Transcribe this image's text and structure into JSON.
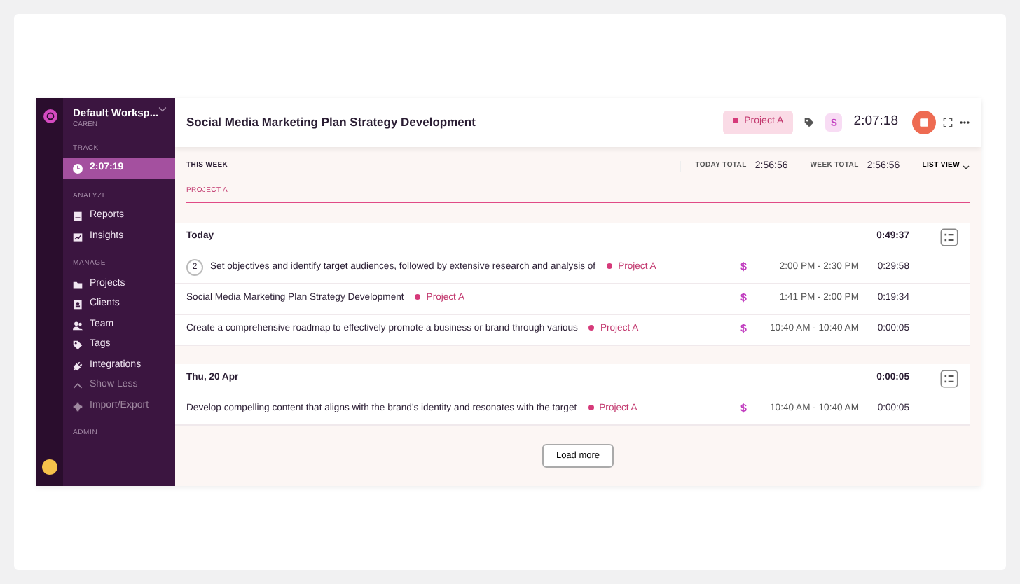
{
  "workspace": {
    "title": "Default Worksp...",
    "subtitle": "CAREN"
  },
  "sidebar": [
    {
      "heading": "TRACK",
      "items": [
        {
          "label": "2:07:19",
          "selected": true,
          "dimmed": false
        }
      ]
    },
    {
      "heading": "ANALYZE",
      "items": [
        {
          "label": "Reports",
          "selected": false,
          "dimmed": false
        },
        {
          "label": "Insights",
          "selected": false,
          "dimmed": false
        }
      ]
    },
    {
      "heading": "MANAGE",
      "items": [
        {
          "label": "Projects",
          "selected": false,
          "dimmed": false
        },
        {
          "label": "Clients",
          "selected": false,
          "dimmed": false
        },
        {
          "label": "Team",
          "selected": false,
          "dimmed": false
        },
        {
          "label": "Tags",
          "selected": false,
          "dimmed": false
        },
        {
          "label": "Integrations",
          "selected": false,
          "dimmed": false
        },
        {
          "label": "Show Less",
          "selected": false,
          "dimmed": true
        },
        {
          "label": "Import/Export",
          "selected": false,
          "dimmed": true
        }
      ]
    },
    {
      "heading": "ADMIN"
    }
  ],
  "timer": {
    "description": "Social Media Marketing Plan Strategy Development",
    "project": "Project A",
    "billable_symbol": "$",
    "elapsed": "2:07:18"
  },
  "summary": {
    "period": "THIS WEEK",
    "today_label": "TODAY TOTAL",
    "today_total": "2:56:56",
    "week_label": "WEEK TOTAL",
    "week_total": "2:56:56",
    "view": "LIST VIEW"
  },
  "filter": {
    "project": "PROJECT A"
  },
  "groups": [
    {
      "date": "Today",
      "total": "0:49:37",
      "entries": [
        {
          "count": "2",
          "description": "Set objectives and identify target audiences, followed by extensive research and analysis of",
          "project": "Project A",
          "billable": "$",
          "range": "2:00 PM - 2:30 PM",
          "duration": "0:29:58"
        },
        {
          "description": "Social Media Marketing Plan Strategy Development",
          "project": "Project A",
          "billable": "$",
          "range": "1:41 PM - 2:00 PM",
          "duration": "0:19:34"
        },
        {
          "description": "Create a comprehensive roadmap to effectively promote a business or brand through various",
          "project": "Project A",
          "billable": "$",
          "range": "10:40 AM - 10:40 AM",
          "duration": "0:00:05"
        }
      ]
    },
    {
      "date": "Thu, 20 Apr",
      "total": "0:00:05",
      "entries": [
        {
          "description": "Develop compelling content that aligns with the brand's identity and resonates with the target",
          "project": "Project A",
          "billable": "$",
          "range": "10:40 AM - 10:40 AM",
          "duration": "0:00:05"
        }
      ]
    }
  ],
  "load_more": "Load more"
}
